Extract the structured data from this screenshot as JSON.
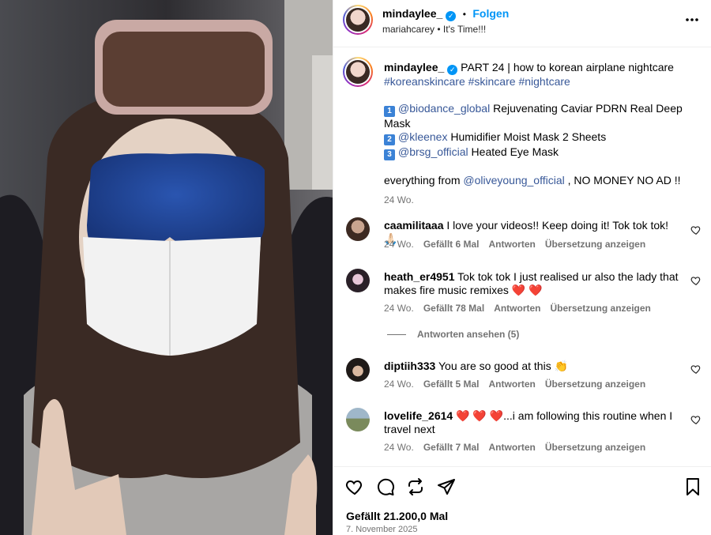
{
  "post": {
    "author": "mindaylee_",
    "follow_separator": "•",
    "follow_label": "Folgen",
    "audio_artist": "mariahcarey",
    "audio_separator": "•",
    "audio_title": "It's Time!!!",
    "more_icon": "more-horizontal-icon"
  },
  "caption": {
    "author": "mindaylee_",
    "title": "PART 24 | how to korean airplane nightcare",
    "hashtags": [
      "#koreanskincare",
      "#skincare",
      "#nightcare"
    ],
    "items": [
      {
        "num": "1",
        "mention": "@biodance_global",
        "text": " Rejuvenating Caviar PDRN Real Deep Mask"
      },
      {
        "num": "2",
        "mention": "@kleenex",
        "text": " Humidifier Moist Mask 2 Sheets"
      },
      {
        "num": "3",
        "mention": "@brsg_official",
        "text": " Heated Eye Mask"
      }
    ],
    "footer_prefix": "everything from ",
    "footer_mention": "@oliveyoung_official",
    "footer_suffix": " , NO MONEY NO AD !!",
    "time": "24 Wo."
  },
  "comments": [
    {
      "user": "caamilitaaa",
      "text": "I love your videos!! Keep doing it! Tok tok tok! 🙏🏻",
      "time": "24 Wo.",
      "likes": "Gefällt 6 Mal",
      "reply": "Antworten",
      "translate": "Übersetzung anzeigen"
    },
    {
      "user": "heath_er4951",
      "text": "Tok tok tok I just realised ur also the lady that makes fire music remixes ❤️ ❤️",
      "time": "24 Wo.",
      "likes": "Gefällt 78 Mal",
      "reply": "Antworten",
      "translate": "Übersetzung anzeigen",
      "view_replies": "Antworten ansehen (5)"
    },
    {
      "user": "diptiih333",
      "text": "You are so good at this 👏",
      "time": "24 Wo.",
      "likes": "Gefällt 5 Mal",
      "reply": "Antworten",
      "translate": "Übersetzung anzeigen"
    },
    {
      "user": "lovelife_2614",
      "text": "❤️ ❤️ ❤️...i am following this routine when I travel next",
      "time": "24 Wo.",
      "likes": "Gefällt 7 Mal",
      "reply": "Antworten",
      "translate": "Übersetzung anzeigen"
    }
  ],
  "actions": {
    "likes": "Gefällt 21.200,0 Mal",
    "date": "7. November 2025",
    "icons": [
      "heart-icon",
      "comment-icon",
      "share-icon",
      "send-icon",
      "bookmark-icon"
    ]
  },
  "colors": {
    "link": "#385898",
    "verified": "#0095f6",
    "meta": "#737373",
    "heart_emoji": "#e8254a"
  }
}
